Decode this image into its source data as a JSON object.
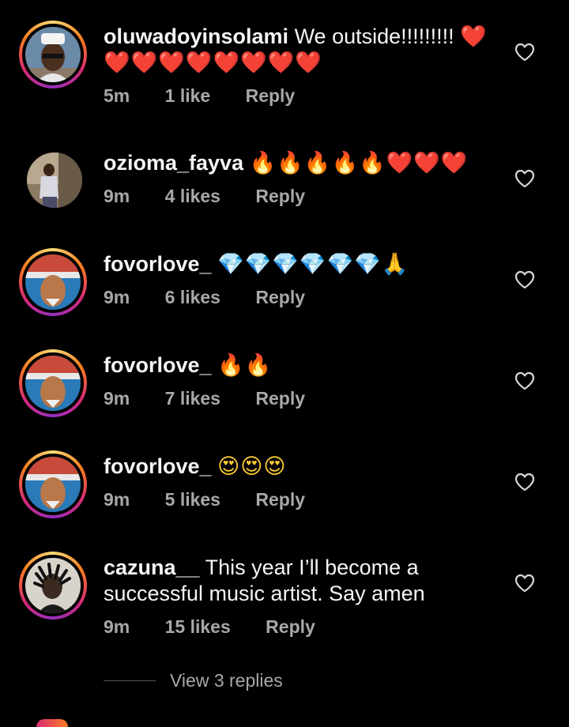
{
  "comments": [
    {
      "username": "oluwadoyinsolami",
      "text": "We outside!!!!!!!!!",
      "emojis_inline": "❤️",
      "emojis_line2": "❤️❤️❤️❤️❤️❤️❤️❤️",
      "time": "5m",
      "likes": "1 like",
      "reply": "Reply"
    },
    {
      "username": "ozioma_fayva",
      "emojis": "🔥🔥🔥🔥🔥❤️❤️❤️",
      "time": "9m",
      "likes": "4 likes",
      "reply": "Reply"
    },
    {
      "username": "fovorlove_",
      "emojis": "💎💎💎💎💎💎🙏",
      "time": "9m",
      "likes": "6 likes",
      "reply": "Reply"
    },
    {
      "username": "fovorlove_",
      "emojis": "🔥🔥",
      "time": "9m",
      "likes": "7 likes",
      "reply": "Reply"
    },
    {
      "username": "fovorlove_",
      "emojis": "😍😍😍",
      "time": "9m",
      "likes": "5 likes",
      "reply": "Reply"
    },
    {
      "username": "cazuna__",
      "text": "This year I’ll become a successful music artist. Say amen",
      "time": "9m",
      "likes": "15 likes",
      "reply": "Reply"
    }
  ],
  "view_replies": "View 3 replies",
  "icons": {
    "like": "heart-outline-icon"
  },
  "colors": {
    "background": "#000000",
    "text": "#f5f5f5",
    "meta": "#a8a8a8",
    "story_ring": "#d62976"
  }
}
